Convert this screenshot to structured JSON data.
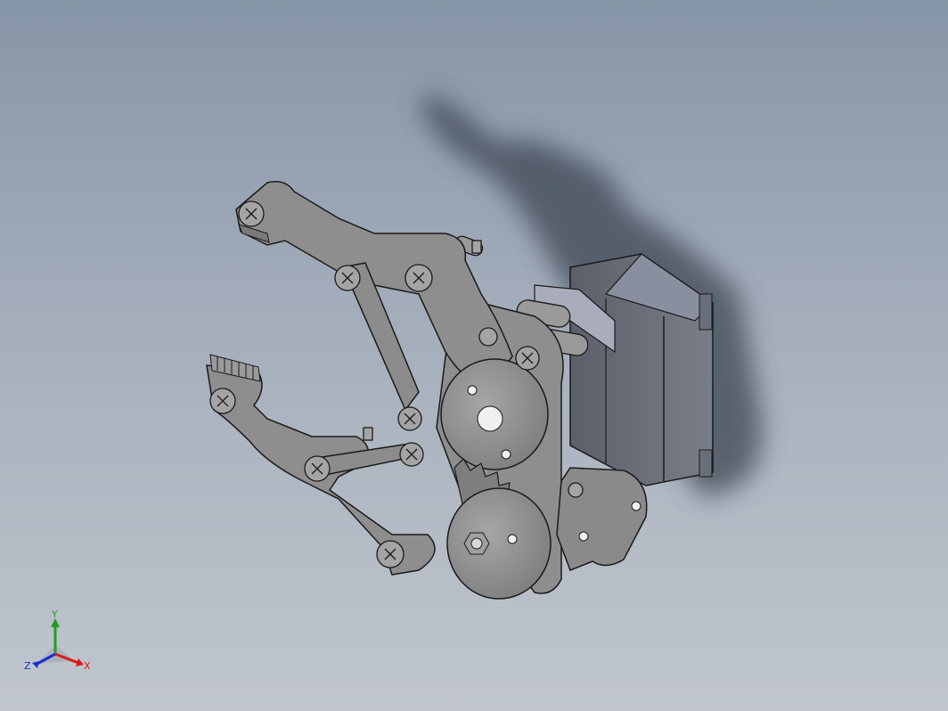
{
  "viewport": {
    "background_top": "#8795a8",
    "background_bottom": "#c1c6ce",
    "part_color": "#8e8e8e",
    "motor_color": "#6b6f7a"
  },
  "triad": {
    "x_label": "X",
    "y_label": "Y",
    "z_label": "Z",
    "x_color": "#e01818",
    "y_color": "#1ea01e",
    "z_color": "#1a2fd0"
  }
}
